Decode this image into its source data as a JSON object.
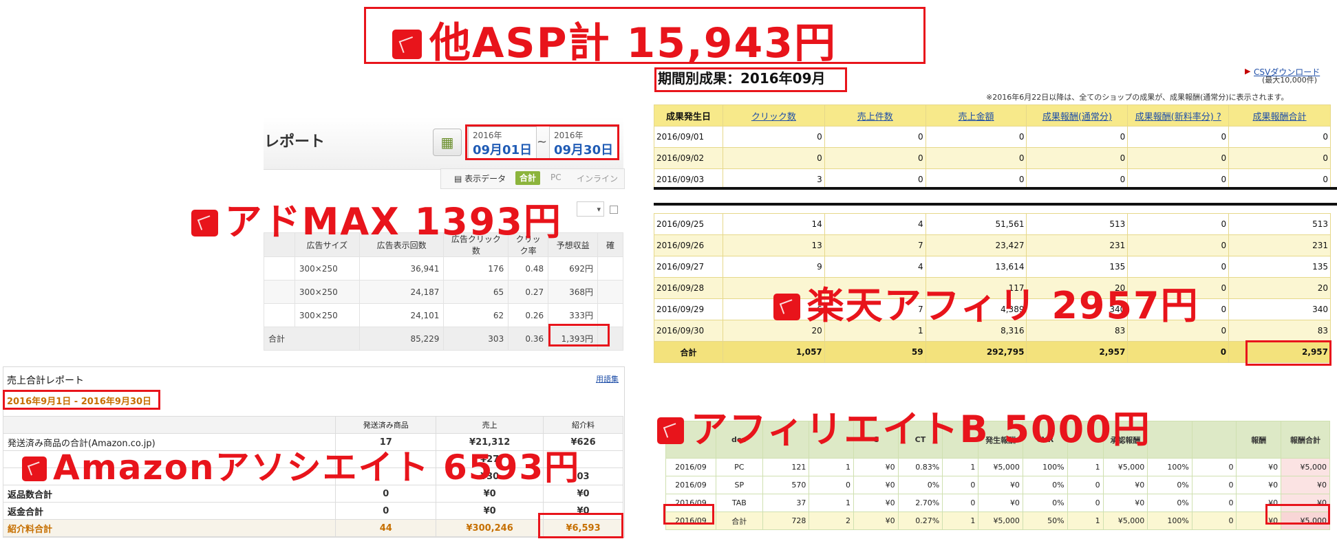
{
  "title": {
    "text": "他ASP計 15,943円"
  },
  "admax": {
    "header_title": "レポート",
    "date_from": {
      "year": "2016年",
      "day": "09月01日"
    },
    "date_to": {
      "year": "2016年",
      "day": "09月30日"
    },
    "date_sep": "~",
    "view_label": "表示データ",
    "view_options": [
      "合計",
      "PC",
      "インライン"
    ],
    "columns": [
      "",
      "広告サイズ",
      "広告表示回数",
      "広告クリック数",
      "クリック率",
      "予想収益",
      "確"
    ],
    "rows": [
      {
        "size": "300×250",
        "impressions": "36,941",
        "clicks": "176",
        "ctr": "0.48",
        "revenue": "692円"
      },
      {
        "size": "300×250",
        "impressions": "24,187",
        "clicks": "65",
        "ctr": "0.27",
        "revenue": "368円"
      },
      {
        "size": "300×250",
        "impressions": "24,101",
        "clicks": "62",
        "ctr": "0.26",
        "revenue": "333円"
      }
    ],
    "total": {
      "label": "合計",
      "impressions": "85,229",
      "clicks": "303",
      "ctr": "0.36",
      "revenue": "1,393円"
    },
    "annotation": "アドMAX 1393円"
  },
  "amazon": {
    "title": "売上合計レポート",
    "glossary": "用語集",
    "period": "2016年9月1日 - 2016年9月30日",
    "columns": [
      "",
      "発送済み商品",
      "売上",
      "紹介料"
    ],
    "rows": [
      {
        "label": "発送済み商品の合計(Amazon.co.jp)",
        "qty": "17",
        "sales": "¥21,312",
        "fee": "¥626"
      },
      {
        "label": "",
        "qty": "",
        "sales": "¥27",
        "fee": ""
      },
      {
        "label": "",
        "qty": "",
        "sales": "¥30",
        "fee": "03"
      },
      {
        "label": "返品数合計",
        "qty": "0",
        "sales": "¥0",
        "fee": "¥0"
      },
      {
        "label": "返金合計",
        "qty": "0",
        "sales": "¥0",
        "fee": "¥0"
      }
    ],
    "fee_total": {
      "label": "紹介料合計",
      "qty": "44",
      "sales": "¥300,246",
      "fee": "¥6,593"
    },
    "annotation": "Amazonアソシエイト 6593円"
  },
  "rakuten": {
    "period_title": "期間別成果：2016年09月",
    "csv_link": "CSVダウンロード",
    "csv_note": "(最大10,000件)",
    "note": "※2016年6月22日以降は、全てのショップの成果が、成果報酬(通常分)に表示されます。",
    "columns": [
      "成果発生日",
      "クリック数",
      "売上件数",
      "売上金額",
      "成果報酬(通常分)",
      "成果報酬(新料率分) ?",
      "成果報酬合計"
    ],
    "rows_top": [
      [
        "2016/09/01",
        "0",
        "0",
        "0",
        "0",
        "0",
        "0"
      ],
      [
        "2016/09/02",
        "0",
        "0",
        "0",
        "0",
        "0",
        "0"
      ],
      [
        "2016/09/03",
        "3",
        "0",
        "0",
        "0",
        "0",
        "0"
      ]
    ],
    "rows_bottom": [
      [
        "2016/09/25",
        "14",
        "4",
        "51,561",
        "513",
        "0",
        "513"
      ],
      [
        "2016/09/26",
        "13",
        "7",
        "23,427",
        "231",
        "0",
        "231"
      ],
      [
        "2016/09/27",
        "9",
        "4",
        "13,614",
        "135",
        "0",
        "135"
      ],
      [
        "2016/09/28",
        "",
        "",
        "117",
        "20",
        "0",
        "20"
      ],
      [
        "2016/09/29",
        "6",
        "7",
        "4,389",
        "340",
        "0",
        "340"
      ],
      [
        "2016/09/30",
        "20",
        "1",
        "8,316",
        "83",
        "0",
        "83"
      ]
    ],
    "total": [
      "合計",
      "1,057",
      "59",
      "292,795",
      "2,957",
      "0",
      "2,957"
    ],
    "annotation": "楽天アフィリ 2957円"
  },
  "affiliate_b": {
    "columns": [
      "",
      "dev",
      "",
      "",
      "C",
      "CT",
      "",
      "発生報酬",
      "CVR",
      "",
      "承認報酬",
      "",
      "",
      "",
      "報酬",
      "報酬合計"
    ],
    "rows": [
      [
        "2016/09",
        "PC",
        "121",
        "1",
        "¥0",
        "0.83%",
        "1",
        "¥5,000",
        "100%",
        "1",
        "¥5,000",
        "100%",
        "0",
        "¥0",
        "¥5,000"
      ],
      [
        "2016/09",
        "SP",
        "570",
        "0",
        "¥0",
        "0%",
        "0",
        "¥0",
        "0%",
        "0",
        "¥0",
        "0%",
        "0",
        "¥0",
        "¥0"
      ],
      [
        "2016/09",
        "TAB",
        "37",
        "1",
        "¥0",
        "2.70%",
        "0",
        "¥0",
        "0%",
        "0",
        "¥0",
        "0%",
        "0",
        "¥0",
        "¥0"
      ]
    ],
    "total": [
      "2016/09",
      "合計",
      "728",
      "2",
      "¥0",
      "0.27%",
      "1",
      "¥5,000",
      "50%",
      "1",
      "¥5,000",
      "100%",
      "0",
      "¥0",
      "¥5,000"
    ],
    "annotation": "アフィリエイトB 5000円"
  },
  "colors": {
    "annotation_red": "#e8141b",
    "rakuten_header": "#f7e98a",
    "afb_header": "#dde9c6",
    "amazon_orange": "#c66f00"
  }
}
